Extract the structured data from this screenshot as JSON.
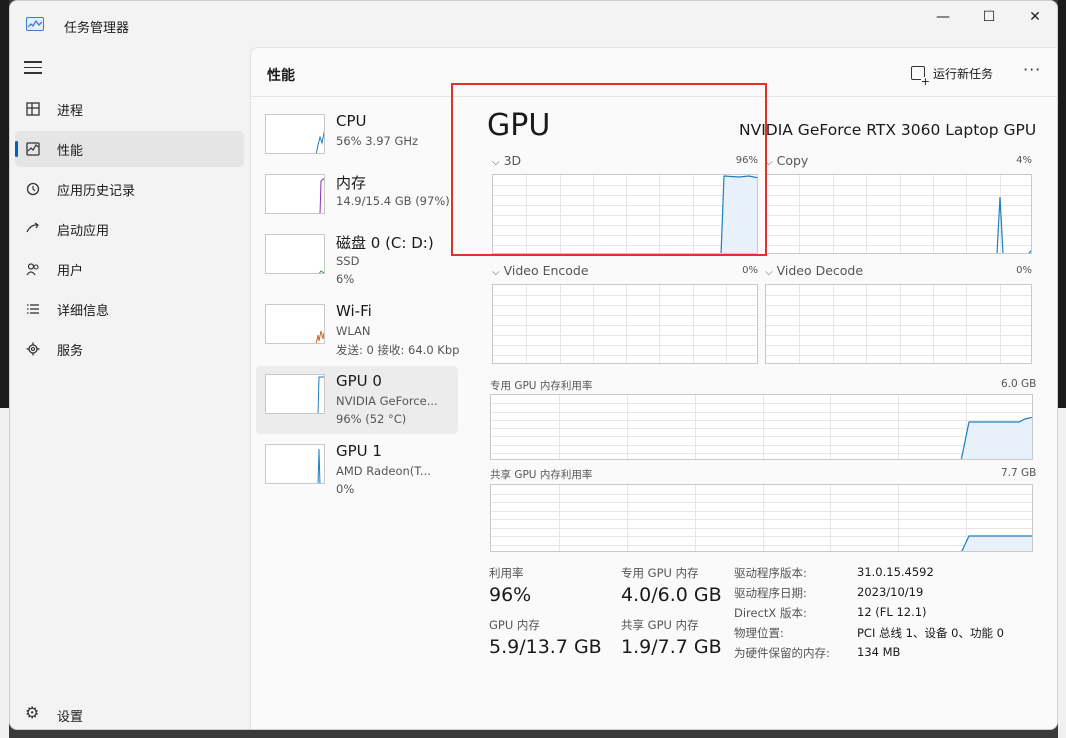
{
  "app": {
    "title": "任务管理器"
  },
  "window_controls": {
    "minimize": "—",
    "maximize": "☐",
    "close": "✕"
  },
  "nav": {
    "items": [
      {
        "label": "进程",
        "icon": "processes-icon"
      },
      {
        "label": "性能",
        "icon": "performance-icon",
        "active": true
      },
      {
        "label": "应用历史记录",
        "icon": "app-history-icon"
      },
      {
        "label": "启动应用",
        "icon": "startup-apps-icon"
      },
      {
        "label": "用户",
        "icon": "users-icon"
      },
      {
        "label": "详细信息",
        "icon": "details-icon"
      },
      {
        "label": "服务",
        "icon": "services-icon"
      }
    ],
    "settings_label": "设置"
  },
  "header": {
    "title": "性能",
    "run_new_task": "运行新任务",
    "more": "···"
  },
  "devices": [
    {
      "name": "CPU",
      "line2": "56%  3.97 GHz",
      "line3": "",
      "color": "#1f7fbf"
    },
    {
      "name": "内存",
      "line2": "14.9/15.4 GB (97%)",
      "line3": "",
      "color": "#8b2bb8"
    },
    {
      "name": "磁盘 0 (C: D:)",
      "line2": "SSD",
      "line3": "6%",
      "color": "#3b9b3b"
    },
    {
      "name": "Wi-Fi",
      "line2": "WLAN",
      "line3": "发送: 0 接收: 64.0 Kbp",
      "color": "#c5672a"
    },
    {
      "name": "GPU 0",
      "line2": "NVIDIA GeForce...",
      "line3": "96% (52 °C)",
      "color": "#1f7fbf",
      "active": true
    },
    {
      "name": "GPU 1",
      "line2": "AMD Radeon(T...",
      "line3": "0%",
      "color": "#1f7fbf"
    }
  ],
  "gpu": {
    "title": "GPU",
    "model": "NVIDIA GeForce RTX 3060 Laptop GPU",
    "engines": [
      {
        "label": "3D",
        "percent": "96%",
        "current_value": 0.96
      },
      {
        "label": "Copy",
        "percent": "4%",
        "current_value": 0.04
      },
      {
        "label": "Video Encode",
        "percent": "0%",
        "current_value": 0
      },
      {
        "label": "Video Decode",
        "percent": "0%",
        "current_value": 0
      }
    ],
    "dedicated_mem": {
      "label": "专用 GPU 内存利用率",
      "max": "6.0 GB"
    },
    "shared_mem": {
      "label": "共享 GPU 内存利用率",
      "max": "7.7 GB"
    }
  },
  "stats": {
    "utilization": {
      "label": "利用率",
      "value": "96%"
    },
    "dedicated": {
      "label": "专用 GPU 内存",
      "value": "4.0/6.0 GB"
    },
    "gpu_memory": {
      "label": "GPU 内存",
      "value": "5.9/13.7 GB"
    },
    "shared": {
      "label": "共享 GPU 内存",
      "value": "1.9/7.7 GB"
    }
  },
  "details": [
    {
      "key": "驱动程序版本:",
      "value": "31.0.15.4592"
    },
    {
      "key": "驱动程序日期:",
      "value": "2023/10/19"
    },
    {
      "key": "DirectX 版本:",
      "value": "12 (FL 12.1)"
    },
    {
      "key": "物理位置:",
      "value": "PCI 总线 1、设备 0、功能 0"
    },
    {
      "key": "为硬件保留的内存:",
      "value": "134 MB"
    }
  ],
  "colors": {
    "accent": "#005fb8",
    "graph_line": "#1f7fbf",
    "highlight": "#e0322b"
  }
}
